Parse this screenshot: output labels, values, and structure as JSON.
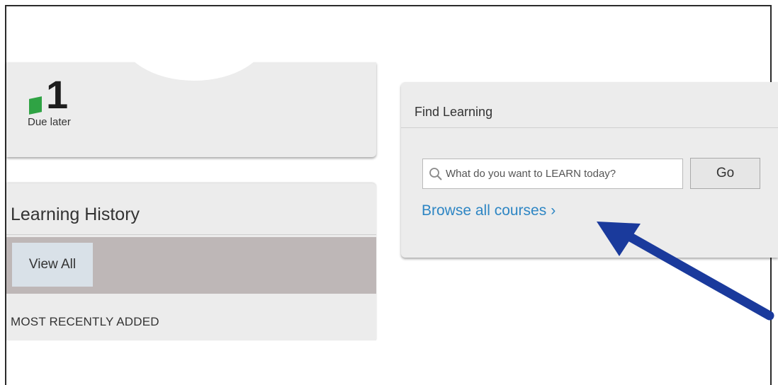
{
  "due_summary": {
    "count": "1",
    "label": "Due later",
    "marker_color": "#2fa344"
  },
  "learning_history": {
    "title": "Learning History",
    "view_all_label": "View All",
    "section_label": "MOST RECENTLY ADDED"
  },
  "find_learning": {
    "title": "Find Learning",
    "search": {
      "placeholder": "What do you want to LEARN today?",
      "value": "",
      "icon": "search-icon"
    },
    "go_label": "Go",
    "browse_label": "Browse all courses",
    "browse_chevron": "›",
    "link_color": "#2e86c4"
  },
  "annotation": {
    "icon": "pointer-arrow-icon",
    "color": "#1a3a9c"
  }
}
